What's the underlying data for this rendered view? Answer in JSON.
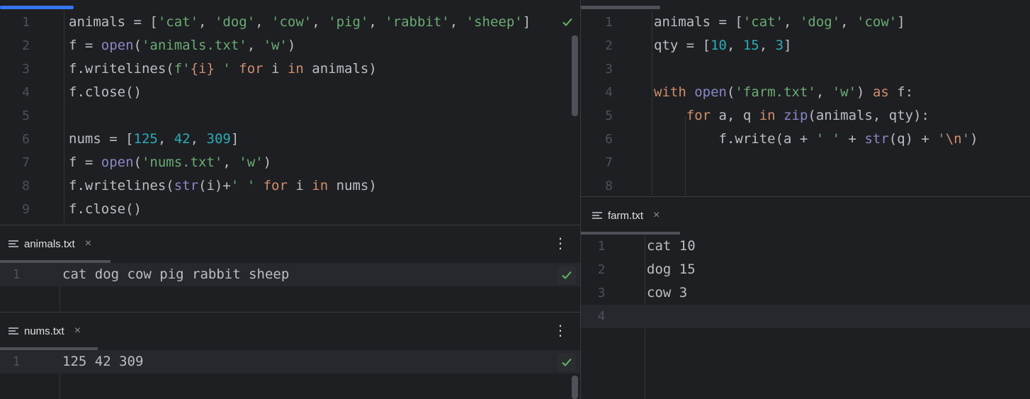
{
  "left_editor": {
    "lines": [
      {
        "n": "1",
        "html": [
          [
            "animals = [",
            ""
          ],
          [
            "'cat'",
            "str"
          ],
          [
            ", ",
            ""
          ],
          [
            "'dog'",
            "str"
          ],
          [
            ", ",
            ""
          ],
          [
            "'cow'",
            "str"
          ],
          [
            ", ",
            ""
          ],
          [
            "'pig'",
            "str"
          ],
          [
            ", ",
            ""
          ],
          [
            "'rabbit'",
            "str"
          ],
          [
            ", ",
            ""
          ],
          [
            "'sheep'",
            "str"
          ],
          [
            "]",
            ""
          ]
        ]
      },
      {
        "n": "2",
        "html": [
          [
            "f = ",
            ""
          ],
          [
            "open",
            "bi"
          ],
          [
            "(",
            ""
          ],
          [
            "'animals.txt'",
            "str"
          ],
          [
            ", ",
            ""
          ],
          [
            "'w'",
            "str"
          ],
          [
            ")",
            ""
          ]
        ]
      },
      {
        "n": "3",
        "html": [
          [
            "f.writelines(",
            ""
          ],
          [
            "f'",
            "str"
          ],
          [
            "{i}",
            "esc"
          ],
          [
            " '",
            "str"
          ],
          [
            " ",
            ""
          ],
          [
            "for",
            "kw"
          ],
          [
            " i ",
            ""
          ],
          [
            "in",
            "kw"
          ],
          [
            " animals)",
            ""
          ]
        ]
      },
      {
        "n": "4",
        "html": [
          [
            "f.close()",
            ""
          ]
        ]
      },
      {
        "n": "5",
        "html": []
      },
      {
        "n": "6",
        "html": [
          [
            "nums = [",
            ""
          ],
          [
            "125",
            "num"
          ],
          [
            ", ",
            ""
          ],
          [
            "42",
            "num"
          ],
          [
            ", ",
            ""
          ],
          [
            "309",
            "num"
          ],
          [
            "]",
            ""
          ]
        ]
      },
      {
        "n": "7",
        "html": [
          [
            "f = ",
            ""
          ],
          [
            "open",
            "bi"
          ],
          [
            "(",
            ""
          ],
          [
            "'nums.txt'",
            "str"
          ],
          [
            ", ",
            ""
          ],
          [
            "'w'",
            "str"
          ],
          [
            ")",
            ""
          ]
        ]
      },
      {
        "n": "8",
        "html": [
          [
            "f.writelines(",
            ""
          ],
          [
            "str",
            "bi"
          ],
          [
            "(i)+",
            ""
          ],
          [
            "' '",
            "str"
          ],
          [
            " ",
            ""
          ],
          [
            "for",
            "kw"
          ],
          [
            " i ",
            ""
          ],
          [
            "in",
            "kw"
          ],
          [
            " nums)",
            ""
          ]
        ]
      },
      {
        "n": "9",
        "html": [
          [
            "f.close()",
            ""
          ]
        ]
      }
    ]
  },
  "right_editor": {
    "lines": [
      {
        "n": "1",
        "html": [
          [
            "animals = [",
            ""
          ],
          [
            "'cat'",
            "str"
          ],
          [
            ", ",
            ""
          ],
          [
            "'dog'",
            "str"
          ],
          [
            ", ",
            ""
          ],
          [
            "'cow'",
            "str"
          ],
          [
            "]",
            ""
          ]
        ]
      },
      {
        "n": "2",
        "html": [
          [
            "qty = [",
            ""
          ],
          [
            "10",
            "num"
          ],
          [
            ", ",
            ""
          ],
          [
            "15",
            "num"
          ],
          [
            ", ",
            ""
          ],
          [
            "3",
            "num"
          ],
          [
            "]",
            ""
          ]
        ]
      },
      {
        "n": "3",
        "html": []
      },
      {
        "n": "4",
        "html": [
          [
            "with",
            "kw"
          ],
          [
            " ",
            ""
          ],
          [
            "open",
            "bi"
          ],
          [
            "(",
            ""
          ],
          [
            "'farm.txt'",
            "str"
          ],
          [
            ", ",
            ""
          ],
          [
            "'w'",
            "str"
          ],
          [
            ") ",
            ""
          ],
          [
            "as",
            "kw"
          ],
          [
            " f:",
            ""
          ]
        ]
      },
      {
        "n": "5",
        "html": [
          [
            "    ",
            ""
          ],
          [
            "for",
            "kw"
          ],
          [
            " a, q ",
            ""
          ],
          [
            "in",
            "kw"
          ],
          [
            " ",
            ""
          ],
          [
            "zip",
            "bi"
          ],
          [
            "(animals, qty):",
            ""
          ]
        ]
      },
      {
        "n": "6",
        "html": [
          [
            "        f.write(a + ",
            ""
          ],
          [
            "' '",
            "str"
          ],
          [
            " + ",
            ""
          ],
          [
            "str",
            "bi"
          ],
          [
            "(q) + ",
            ""
          ],
          [
            "'",
            "str"
          ],
          [
            "\\n",
            "esc"
          ],
          [
            "'",
            "str"
          ],
          [
            ")",
            ""
          ]
        ]
      },
      {
        "n": "7",
        "html": []
      },
      {
        "n": "8",
        "html": []
      }
    ]
  },
  "animals_panel": {
    "tab_label": "animals.txt",
    "close_glyph": "×",
    "more_glyph": "⋮",
    "lines": [
      {
        "n": "1",
        "text": "cat dog cow pig rabbit sheep"
      }
    ]
  },
  "nums_panel": {
    "tab_label": "nums.txt",
    "close_glyph": "×",
    "more_glyph": "⋮",
    "lines": [
      {
        "n": "1",
        "text": "125 42 309"
      }
    ]
  },
  "farm_panel": {
    "tab_label": "farm.txt",
    "close_glyph": "×",
    "lines": [
      {
        "n": "1",
        "text": "cat 10"
      },
      {
        "n": "2",
        "text": "dog 15"
      },
      {
        "n": "3",
        "text": "cow 3"
      },
      {
        "n": "4",
        "text": ""
      }
    ]
  },
  "colors": {
    "accent": "#3574f0",
    "check": "#5fb865"
  }
}
